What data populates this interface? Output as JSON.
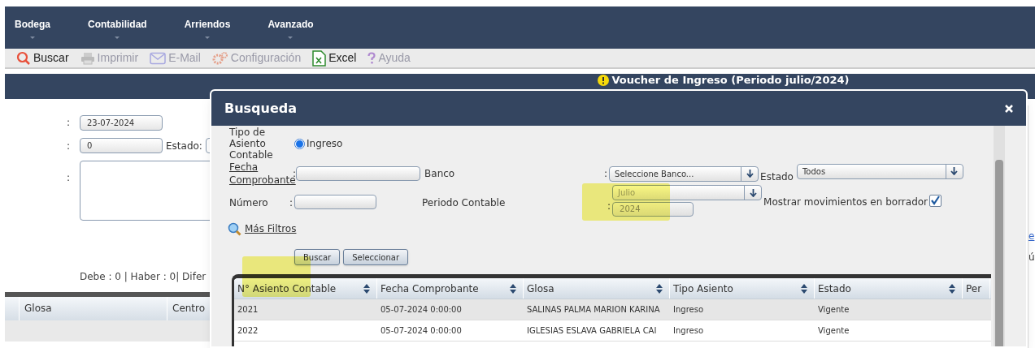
{
  "nav_menu": [
    "Bodega",
    "Contabilidad",
    "Arriendos",
    "Avanzado"
  ],
  "toolbar": [
    {
      "kind": "search",
      "label": "Buscar",
      "disabled": false
    },
    {
      "kind": "print",
      "label": "Imprimir",
      "disabled": true
    },
    {
      "kind": "mail",
      "label": "E-Mail",
      "disabled": true
    },
    {
      "kind": "gear",
      "label": "Configuración",
      "disabled": true
    },
    {
      "kind": "excel",
      "label": "Excel",
      "disabled": false
    },
    {
      "kind": "help",
      "label": "Ayuda",
      "disabled": true
    }
  ],
  "page_title": "Voucher de Ingreso (Periodo julio/2024)",
  "form": {
    "colons": [
      ":",
      ":",
      ":"
    ],
    "fecha": "23-07-2024",
    "numero": "0",
    "estado_label": "Estado:",
    "totals": "Debe : 0 | Haber : 0| Difer"
  },
  "grid": {
    "columns": [
      "Glosa",
      "Centro"
    ]
  },
  "side_fragments": [
    "e",
    "ú"
  ],
  "modal": {
    "title": "Busqueda",
    "tipo": {
      "label": "Tipo de Asiento Contable",
      "options": [
        {
          "label": "Ingreso",
          "selected": true
        }
      ]
    },
    "fecha": {
      "label": "Fecha Comprobante",
      "colon": ":"
    },
    "banco": {
      "label": "Banco",
      "colon": ":",
      "value": "Seleccione Banco..."
    },
    "estado": {
      "label": "Estado",
      "value": "Todos"
    },
    "numero": {
      "label": "Número",
      "colon": ":"
    },
    "periodo": {
      "label": "Periodo Contable",
      "colon": ":",
      "month": "Julio",
      "year": "2024"
    },
    "mostrar": {
      "label": "Mostrar movimientos en borrador",
      "checked": true
    },
    "more_filters": "Más Filtros",
    "buttons": [
      "Buscar",
      "Seleccionar"
    ],
    "table": {
      "columns": [
        "N° Asiento Contable",
        "Fecha Comprobante",
        "Glosa",
        "Tipo Asiento",
        "Estado",
        "Per"
      ],
      "rows": [
        [
          "2021",
          "05-07-2024 0:00:00",
          "SALINAS PALMA MARION KARINA",
          "Ingreso",
          "Vigente"
        ],
        [
          "2022",
          "05-07-2024 0:00:00",
          "IGLESIAS ESLAVA GABRIELA CAI",
          "Ingreso",
          "Vigente"
        ]
      ]
    }
  }
}
